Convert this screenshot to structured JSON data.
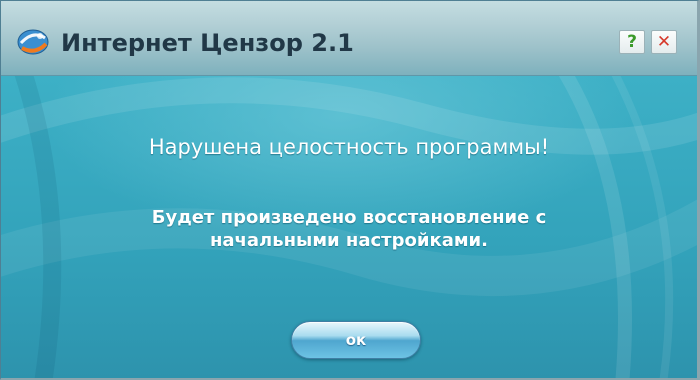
{
  "window": {
    "title": "Интернет Цензор 2.1",
    "icons": {
      "app": "app-logo-icon",
      "help": "help-icon",
      "close": "close-icon"
    },
    "help_glyph": "?",
    "close_glyph": "✕"
  },
  "message": {
    "headline": "Нарушена целостность программы!",
    "details_line1": "Будет произведено восстановление с",
    "details_line2": "начальными настройками."
  },
  "buttons": {
    "ok_label": "ок"
  },
  "colors": {
    "body": "#35a6be",
    "titlebar": "#b3d0d6",
    "title_text": "#213847",
    "help": "#3a9a2a",
    "close": "#d6392b",
    "message_text": "#ffffff",
    "ok_button": "#4fa6cf"
  }
}
